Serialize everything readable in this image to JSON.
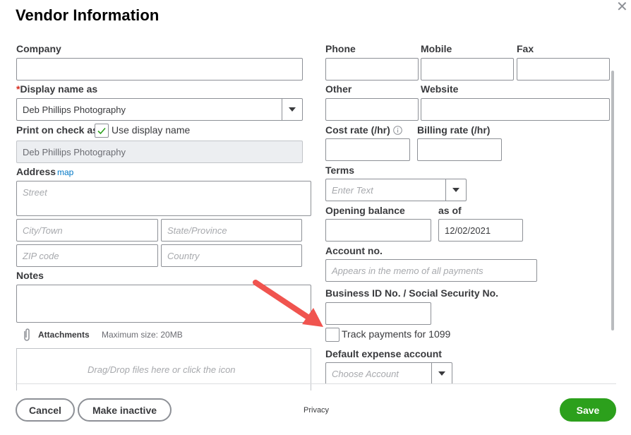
{
  "dialog": {
    "title": "Vendor Information",
    "close_glyph": "✕"
  },
  "left": {
    "company_label": "Company",
    "company_value": "",
    "display_name_required_mark": "*",
    "display_name_label": "Display name as",
    "display_name_value": "Deb Phillips Photography",
    "print_on_check_label": "Print on check as",
    "use_display_name_checked": true,
    "use_display_name_label": "Use display name",
    "print_on_check_value": "Deb Phillips Photography",
    "address_label": "Address",
    "map_link": "map",
    "street_placeholder": "Street",
    "city_placeholder": "City/Town",
    "state_placeholder": "State/Province",
    "zip_placeholder": "ZIP code",
    "country_placeholder": "Country",
    "notes_label": "Notes",
    "attachments_label": "Attachments",
    "attachments_max": "Maximum size: 20MB",
    "dropzone_text": "Drag/Drop files here or click the icon"
  },
  "right": {
    "phone_label": "Phone",
    "mobile_label": "Mobile",
    "fax_label": "Fax",
    "other_label": "Other",
    "website_label": "Website",
    "cost_rate_label": "Cost rate (/hr)",
    "billing_rate_label": "Billing rate (/hr)",
    "terms_label": "Terms",
    "terms_placeholder": "Enter Text",
    "opening_balance_label": "Opening balance",
    "as_of_label": "as of",
    "as_of_value": "12/02/2021",
    "account_no_label": "Account no.",
    "account_no_placeholder": "Appears in the memo of all payments",
    "business_id_label": "Business ID No. / Social Security No.",
    "track_1099_label": "Track payments for 1099",
    "track_1099_checked": false,
    "default_expense_label": "Default expense account",
    "default_expense_placeholder": "Choose Account"
  },
  "footer": {
    "cancel_label": "Cancel",
    "make_inactive_label": "Make inactive",
    "privacy_label": "Privacy",
    "save_label": "Save"
  },
  "colors": {
    "save_green": "#2ca01c",
    "link_blue": "#0077c5",
    "required_red": "#d52b1e",
    "annotation_arrow": "#f0544f"
  }
}
